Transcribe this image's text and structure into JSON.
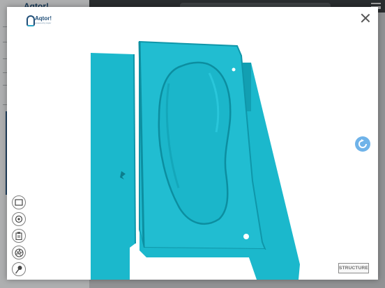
{
  "app": {
    "logo_text": "Aqtor!"
  },
  "modal": {
    "brand_name": "Aqtor!",
    "brand_tagline": "powered by Aqtor",
    "close_label": "×"
  },
  "viewer": {
    "colors": {
      "scan": "#1bb8cc",
      "scan_shadow": "#0f96a9",
      "rotate_button": "#6fb3e9"
    }
  },
  "toolbar": {
    "tools": [
      {
        "icon": "crop-frame-icon"
      },
      {
        "icon": "target-icon"
      },
      {
        "icon": "clipboard-icon"
      },
      {
        "icon": "aperture-icon"
      },
      {
        "icon": "pin-icon"
      }
    ]
  },
  "badge": {
    "text": "STRUCTURE"
  }
}
